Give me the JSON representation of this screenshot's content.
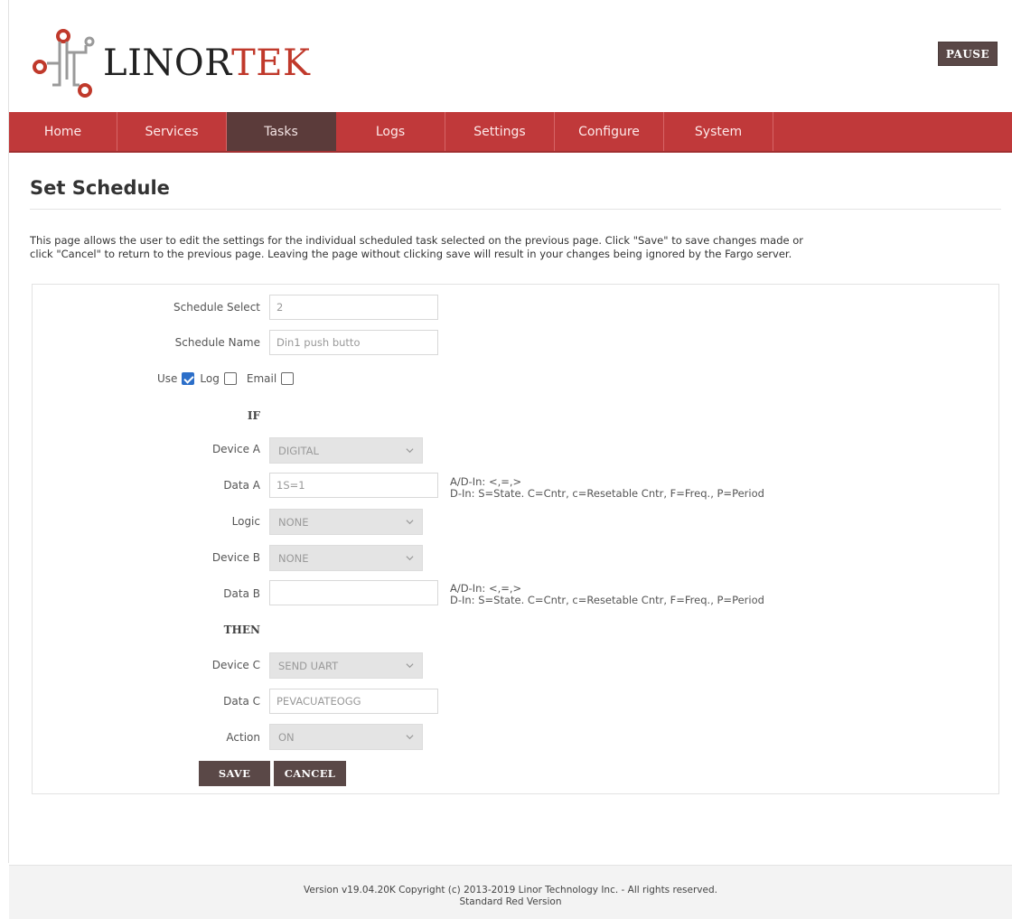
{
  "brand": {
    "logo_text_main": "LINOR",
    "logo_text_accent": "TEK",
    "accent_color": "#c0392b"
  },
  "header": {
    "pause_label": "PAUSE"
  },
  "nav": {
    "items": [
      {
        "label": "Home"
      },
      {
        "label": "Services"
      },
      {
        "label": "Tasks"
      },
      {
        "label": "Logs"
      },
      {
        "label": "Settings"
      },
      {
        "label": "Configure"
      },
      {
        "label": "System"
      }
    ],
    "active": "Tasks"
  },
  "page": {
    "title": "Set Schedule",
    "description_line1": "This page allows the user to edit the settings for the individual scheduled task selected on the previous page. Click \"Save\" to save changes made or",
    "description_line2": "click \"Cancel\" to return to the previous page. Leaving the page without clicking save will result in your changes being ignored by the Fargo server."
  },
  "form": {
    "schedule_select": {
      "label": "Schedule Select",
      "value": "2"
    },
    "schedule_name": {
      "label": "Schedule Name",
      "value": "Din1 push butto"
    },
    "use": {
      "label": "Use",
      "checked": true
    },
    "log": {
      "label": "Log",
      "checked": false
    },
    "email": {
      "label": "Email",
      "checked": false
    },
    "if_label": "IF",
    "device_a": {
      "label": "Device A",
      "value": "DIGITAL"
    },
    "data_a": {
      "label": "Data A",
      "value": "1S=1"
    },
    "hint_a_line1": "A/D-In: <,=,>",
    "hint_a_line2": "D-In: S=State. C=Cntr, c=Resetable Cntr, F=Freq., P=Period",
    "logic": {
      "label": "Logic",
      "value": "NONE"
    },
    "device_b": {
      "label": "Device B",
      "value": "NONE"
    },
    "data_b": {
      "label": "Data B",
      "value": ""
    },
    "hint_b_line1": "A/D-In: <,=,>",
    "hint_b_line2": "D-In: S=State. C=Cntr, c=Resetable Cntr, F=Freq., P=Period",
    "then_label": "THEN",
    "device_c": {
      "label": "Device C",
      "value": "SEND UART"
    },
    "data_c": {
      "label": "Data C",
      "value": "PEVACUATEOGG"
    },
    "action": {
      "label": "Action",
      "value": "ON"
    },
    "save_label": "SAVE",
    "cancel_label": "CANCEL"
  },
  "footer": {
    "line1": "Version v19.04.20K Copyright (c) 2013-2019 Linor Technology Inc. - All rights reserved.",
    "line2": "Standard Red Version"
  }
}
